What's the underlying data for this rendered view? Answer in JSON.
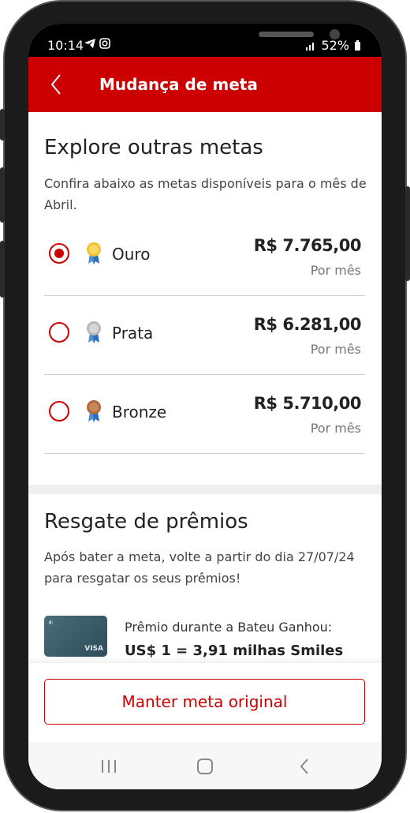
{
  "status_bar": {
    "time": "10:14",
    "battery": "52%",
    "left_icons": "telegram-icon, instagram-icon",
    "right_icons": "lte-icon, signal-icon, battery-icon"
  },
  "header": {
    "title": "Mudança de meta",
    "back_icon": "chevron-left-icon"
  },
  "explore": {
    "title": "Explore outras metas",
    "description": "Confira abaixo as metas disponíveis para o mês de Abril.",
    "options": [
      {
        "label": "Ouro",
        "value": "R$ 7.765,00",
        "period": "Por mês",
        "selected": true,
        "medal_icon": "gold-medal-icon"
      },
      {
        "label": "Prata",
        "value": "R$ 6.281,00",
        "period": "Por mês",
        "selected": false,
        "medal_icon": "silver-medal-icon"
      },
      {
        "label": "Bronze",
        "value": "R$ 5.710,00",
        "period": "Por mês",
        "selected": false,
        "medal_icon": "bronze-medal-icon"
      }
    ]
  },
  "rewards": {
    "title": "Resgate de prêmios",
    "description": "Após bater a meta, volte a partir do dia 27/07/24 para resgatar os seus prêmios!",
    "prize_label": "Prêmio durante a Bateu Ganhou:",
    "prize_value": "US$ 1 = 3,91 milhas Smiles",
    "card_brand": "VISA"
  },
  "footer": {
    "button_label": "Manter meta original"
  },
  "colors": {
    "accent": "#cc0000",
    "header_bg": "#cc0000",
    "text_primary": "#222222",
    "text_secondary": "#777777"
  }
}
